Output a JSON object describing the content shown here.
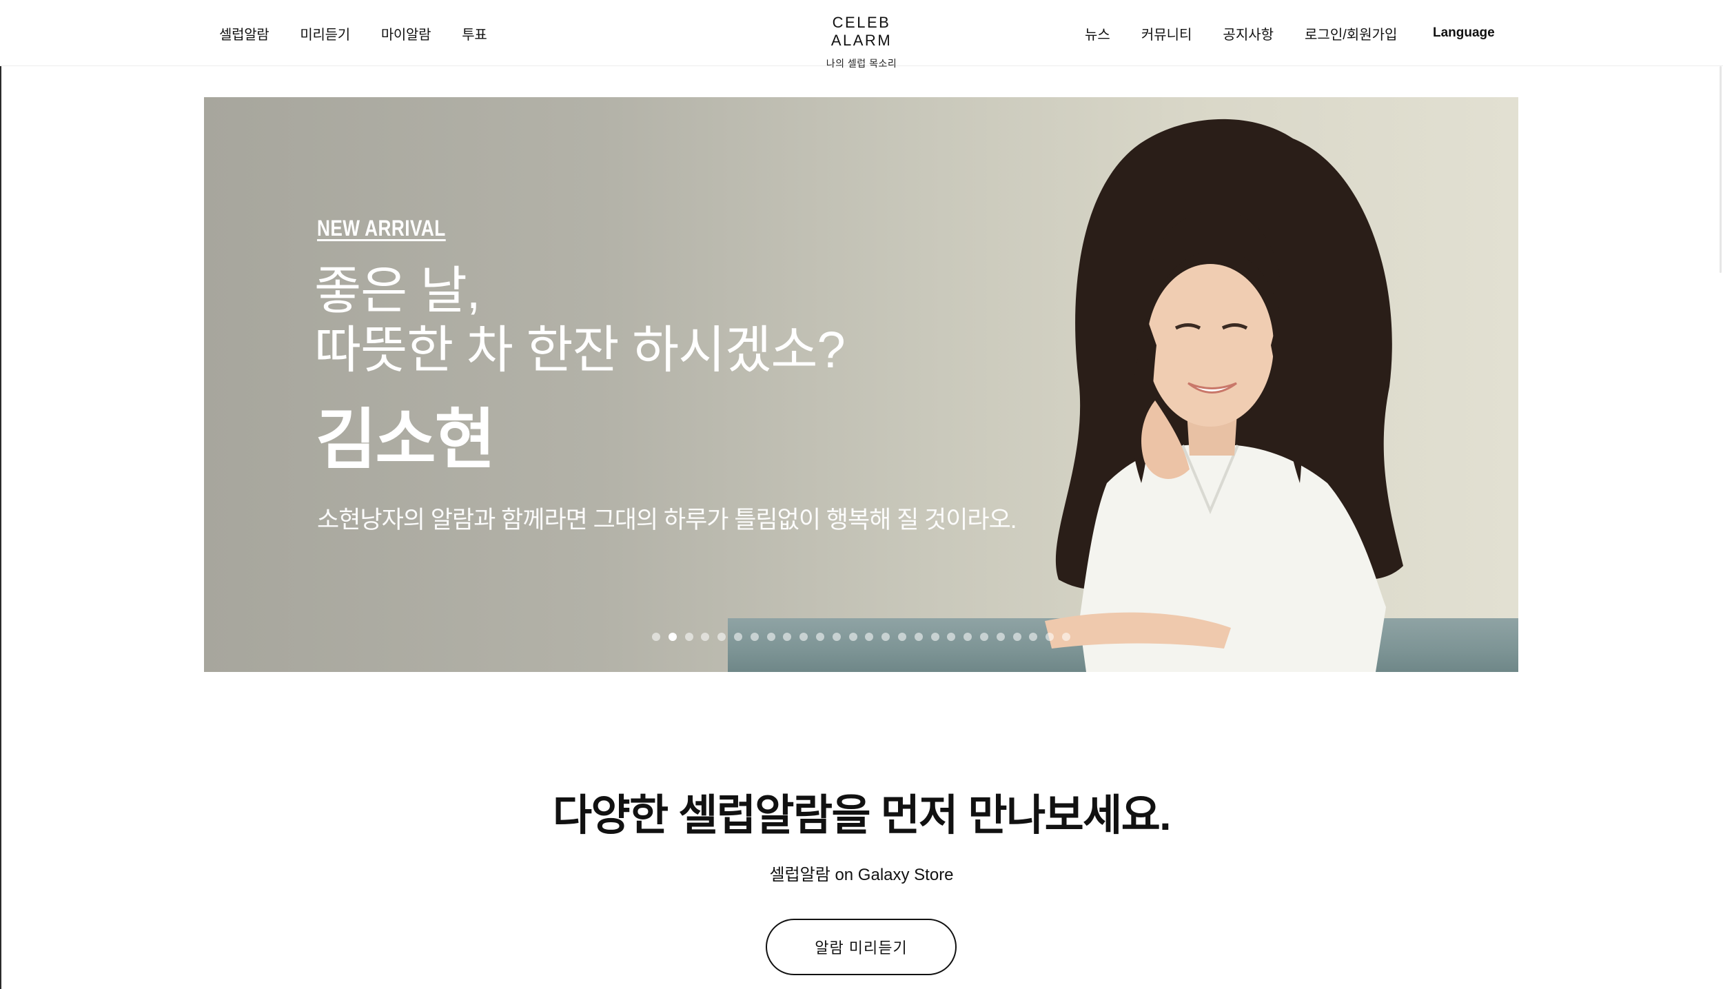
{
  "header": {
    "nav_left": [
      "셀럽알람",
      "미리듣기",
      "마이알람",
      "투표"
    ],
    "logo_title": "CELEB ALARM",
    "logo_subtitle": "나의 셀럽 목소리",
    "nav_right": [
      "뉴스",
      "커뮤니티",
      "공지사항",
      "로그인/회원가입"
    ],
    "language": "Language"
  },
  "hero": {
    "tag": "NEW ARRIVAL",
    "line1": "좋은 날,",
    "line2": "따뜻한 차 한잔 하시겠소?",
    "name": "김소현",
    "description": "소현낭자의 알람과 함께라면 그대의 하루가 틀림없이 행복해 질 것이라오.",
    "slide_count": 26,
    "active_slide": 2
  },
  "promo": {
    "title": "다양한 셀럽알람을 먼저 만나보세요.",
    "subtitle": "셀럽알람 on Galaxy Store",
    "button_label": "알람 미리듣기"
  },
  "colors": {
    "text": "#111111",
    "hero_bg_left": "#a7a69d",
    "hero_bg_right": "#e2e0d2",
    "white": "#ffffff"
  }
}
